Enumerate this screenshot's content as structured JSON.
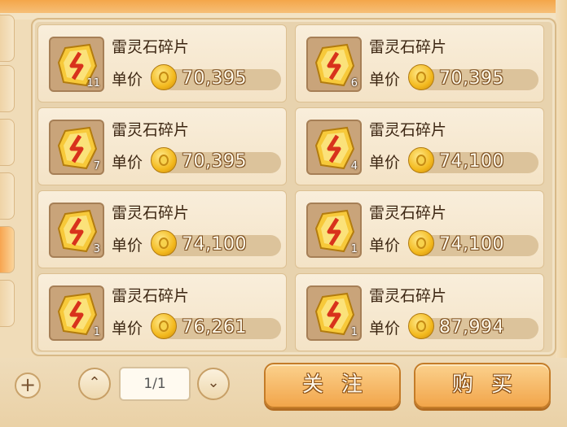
{
  "listings": [
    {
      "name": "雷灵石碎片",
      "price_label": "单价",
      "quantity": "11",
      "price": "70,395"
    },
    {
      "name": "雷灵石碎片",
      "price_label": "单价",
      "quantity": "6",
      "price": "70,395"
    },
    {
      "name": "雷灵石碎片",
      "price_label": "单价",
      "quantity": "7",
      "price": "70,395"
    },
    {
      "name": "雷灵石碎片",
      "price_label": "单价",
      "quantity": "4",
      "price": "74,100"
    },
    {
      "name": "雷灵石碎片",
      "price_label": "单价",
      "quantity": "3",
      "price": "74,100"
    },
    {
      "name": "雷灵石碎片",
      "price_label": "单价",
      "quantity": "1",
      "price": "74,100"
    },
    {
      "name": "雷灵石碎片",
      "price_label": "单价",
      "quantity": "1",
      "price": "76,261"
    },
    {
      "name": "雷灵石碎片",
      "price_label": "单价",
      "quantity": "1",
      "price": "87,994"
    }
  ],
  "icons": {
    "item": "thunder-stone-icon",
    "currency": "coin-icon",
    "prev_page": "chevron-up-icon",
    "next_page": "chevron-down-icon",
    "add": "plus-icon"
  },
  "pagination": {
    "text": "1/1",
    "prev_symbol": "⌃",
    "next_symbol": "⌄"
  },
  "actions": {
    "follow_label": "关注",
    "buy_label": "购买",
    "add_symbol": "+"
  },
  "colors": {
    "accent": "#f2a54a",
    "panel": "#e8d3ae",
    "text": "#3c2612"
  }
}
